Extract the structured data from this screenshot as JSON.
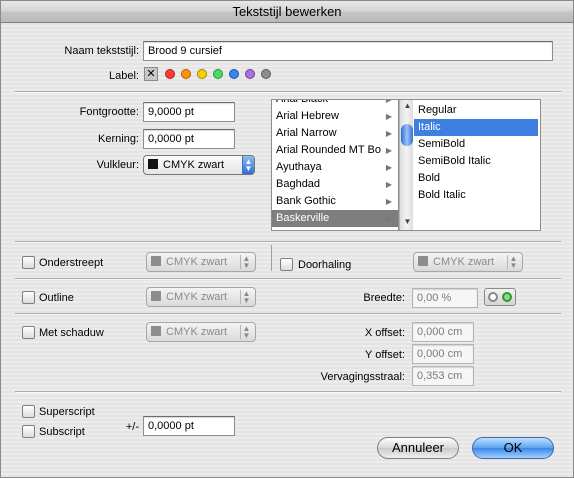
{
  "window": {
    "title": "Tekststijl bewerken"
  },
  "style_name": {
    "label": "Naam tekststijl:",
    "value": "Brood 9 cursief"
  },
  "label_row": {
    "label": "Label:",
    "none_glyph": "✕",
    "colors": [
      "#ff3b30",
      "#ff9500",
      "#ffcc00",
      "#4cd964",
      "#3b82f6",
      "#b06ee0",
      "#8e8e8e"
    ]
  },
  "font": {
    "size_label": "Fontgrootte:",
    "size_value": "9,0000 pt",
    "kerning_label": "Kerning:",
    "kerning_value": "0,0000 pt",
    "color_label": "Vulkleur:",
    "color_value": "CMYK zwart",
    "families": [
      "Arial Black",
      "Arial Hebrew",
      "Arial Narrow",
      "Arial Rounded MT Bo",
      "Ayuthaya",
      "Baghdad",
      "Bank Gothic",
      "Baskerville"
    ],
    "selected_family": "Baskerville",
    "styles": [
      "Regular",
      "Italic",
      "SemiBold",
      "SemiBold Italic",
      "Bold",
      "Bold Italic"
    ],
    "selected_style": "Italic"
  },
  "underline": {
    "label": "Onderstreept",
    "color": "CMYK zwart"
  },
  "strikethrough": {
    "label": "Doorhaling",
    "color": "CMYK zwart"
  },
  "outline": {
    "label": "Outline",
    "color": "CMYK zwart",
    "width_label": "Breedte:",
    "width_value": "0,00 %"
  },
  "shadow": {
    "label": "Met schaduw",
    "color": "CMYK zwart",
    "x_label": "X offset:",
    "x_value": "0,000 cm",
    "y_label": "Y offset:",
    "y_value": "0,000 cm",
    "blur_label": "Vervagingsstraal:",
    "blur_value": "0,353 cm"
  },
  "script": {
    "superscript_label": "Superscript",
    "subscript_label": "Subscript",
    "offset_label": "+/-",
    "offset_value": "0,0000 pt"
  },
  "buttons": {
    "cancel": "Annuleer",
    "ok": "OK"
  }
}
